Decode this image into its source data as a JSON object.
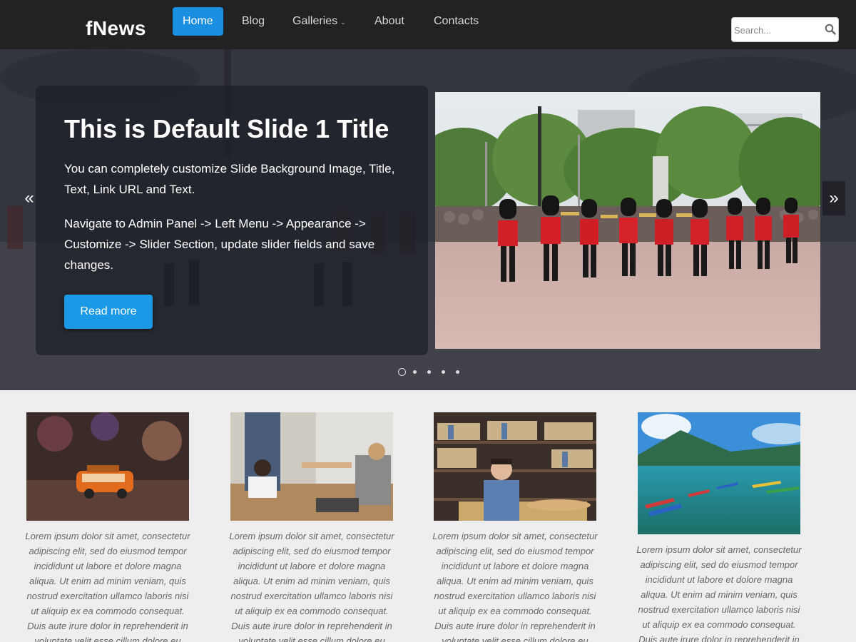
{
  "site": {
    "logo": "fNews"
  },
  "nav": {
    "items": [
      {
        "label": "Home",
        "active": true
      },
      {
        "label": "Blog"
      },
      {
        "label": "Galleries",
        "caret": "⌄"
      },
      {
        "label": "About"
      },
      {
        "label": "Contacts"
      }
    ]
  },
  "search": {
    "placeholder": "Search...",
    "icon": "search-icon"
  },
  "slider": {
    "title": "This is Default Slide 1 Title",
    "text1": "You can completely customize Slide Background Image, Title, Text, Link URL and Text.",
    "text2": "Navigate to Admin Panel -> Left Menu -> Appearance -> Customize -> Slider Section, update slider fields and save changes.",
    "button": "Read more",
    "prev": "«",
    "next": "»",
    "current_slide": 1,
    "slide_count": 5
  },
  "cards": [
    {
      "image": "toy-van-photo",
      "text": "Lorem ipsum dolor sit amet, consectetur adipiscing elit, sed do eiusmod tempor incididunt ut labore et dolore magna aliqua. Ut enim ad minim veniam, quis nostrud exercitation ullamco laboris nisi ut aliquip ex ea commodo consequat. Duis aute irure dolor in reprehenderit in voluptate velit esse cillum dolore eu"
    },
    {
      "image": "handshake-meeting-photo",
      "text": "Lorem ipsum dolor sit amet, consectetur adipiscing elit, sed do eiusmod tempor incididunt ut labore et dolore magna aliqua. Ut enim ad minim veniam, quis nostrud exercitation ullamco laboris nisi ut aliquip ex ea commodo consequat. Duis aute irure dolor in reprehenderit in voluptate velit esse cillum dolore eu"
    },
    {
      "image": "library-student-photo",
      "text": "Lorem ipsum dolor sit amet, consectetur adipiscing elit, sed do eiusmod tempor incididunt ut labore et dolore magna aliqua. Ut enim ad minim veniam, quis nostrud exercitation ullamco laboris nisi ut aliquip ex ea commodo consequat. Duis aute irure dolor in reprehenderit in voluptate velit esse cillum dolore eu"
    },
    {
      "image": "lake-boats-photo",
      "text": "Lorem ipsum dolor sit amet, consectetur adipiscing elit, sed do eiusmod tempor incididunt ut labore et dolore magna aliqua. Ut enim ad minim veniam, quis nostrud exercitation ullamco laboris nisi ut aliquip ex ea commodo consequat. Duis aute irure dolor in reprehenderit in"
    }
  ],
  "colors": {
    "header_bg": "#222222",
    "accent": "#1a8ee0",
    "button": "#1a9ae6",
    "page_bg": "#eeeeee",
    "card_text": "#666666"
  }
}
